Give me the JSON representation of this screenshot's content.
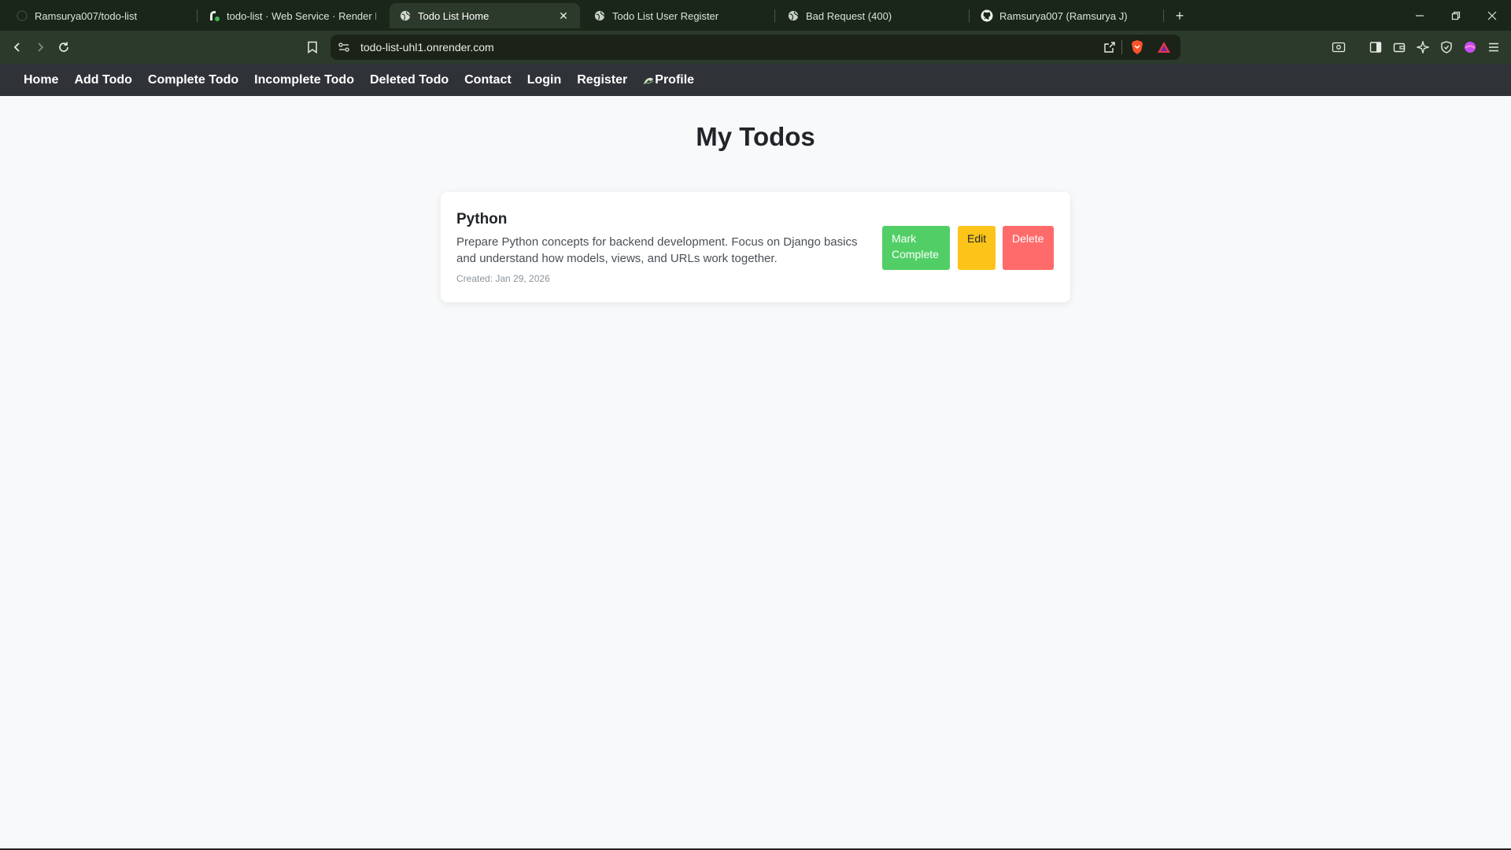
{
  "browser": {
    "tabs": [
      {
        "label": "Ramsurya007/todo-list",
        "icon": "github-icon",
        "active": false
      },
      {
        "label": "todo-list · Web Service · Render Das",
        "icon": "render-icon",
        "active": false
      },
      {
        "label": "Todo List Home",
        "icon": "globe-icon",
        "active": true
      },
      {
        "label": "Todo List User Register",
        "icon": "globe-icon",
        "active": false
      },
      {
        "label": "Bad Request (400)",
        "icon": "globe-icon",
        "active": false
      },
      {
        "label": "Ramsurya007 (Ramsurya J)",
        "icon": "github-icon",
        "active": false
      }
    ],
    "close_glyph": "✕",
    "new_tab_glyph": "+",
    "url": "todo-list-uhl1.onrender.com"
  },
  "nav": {
    "items": [
      "Home",
      "Add Todo",
      "Complete Todo",
      "Incomplete Todo",
      "Deleted Todo",
      "Contact",
      "Login",
      "Register",
      "Profile"
    ]
  },
  "main": {
    "title": "My Todos",
    "todos": [
      {
        "title": "Python",
        "description": "Prepare Python concepts for backend development. Focus on Django basics and understand how models, views, and URLs work together.",
        "created": "Created: Jan 29, 2026",
        "actions": {
          "complete": "Mark Complete",
          "edit": "Edit",
          "delete": "Delete"
        }
      }
    ]
  },
  "colors": {
    "complete": "#51cf66",
    "edit": "#fcc419",
    "delete": "#ff6b6b",
    "nav_bg": "#2f3237",
    "chrome_bg": "#1a2619"
  }
}
